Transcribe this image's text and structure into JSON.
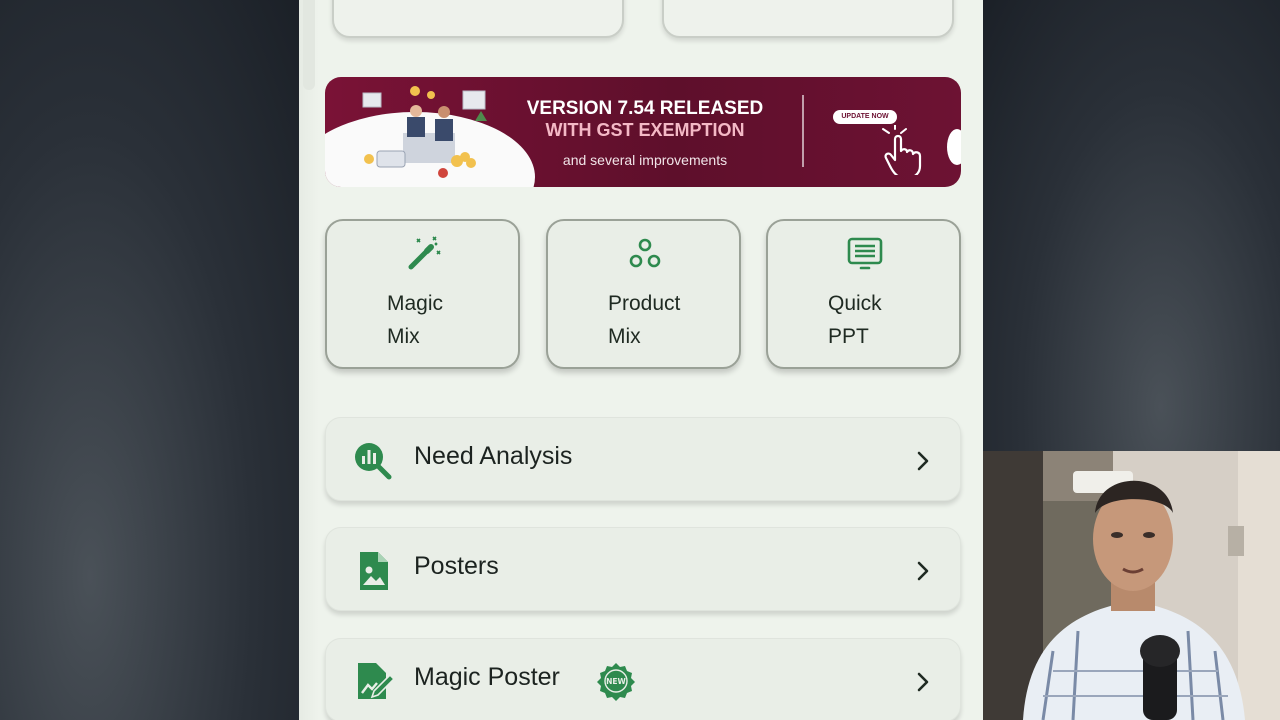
{
  "banner": {
    "headline": "VERSION 7.54 RELEASED",
    "subheadline": "WITH GST EXEMPTION",
    "tagline": "and several improvements",
    "cta": "UPDATE NOW",
    "colors": {
      "background": "#6d1233",
      "accent": "#f4b9c6"
    }
  },
  "tiles": [
    {
      "label": "Magic Mix",
      "icon": "magic-wand-icon"
    },
    {
      "label": "Product Mix",
      "icon": "product-mix-icon"
    },
    {
      "label": "Quick PPT",
      "icon": "presentation-icon"
    }
  ],
  "menu": [
    {
      "label": "Need Analysis",
      "icon": "analysis-search-icon"
    },
    {
      "label": "Posters",
      "icon": "poster-file-icon"
    },
    {
      "label": "Magic Poster",
      "icon": "edit-poster-icon",
      "badge": "NEW"
    }
  ],
  "theme": {
    "primary": "#2e8a4e",
    "surface": "#e9eee7",
    "background": "#eef3ec"
  }
}
